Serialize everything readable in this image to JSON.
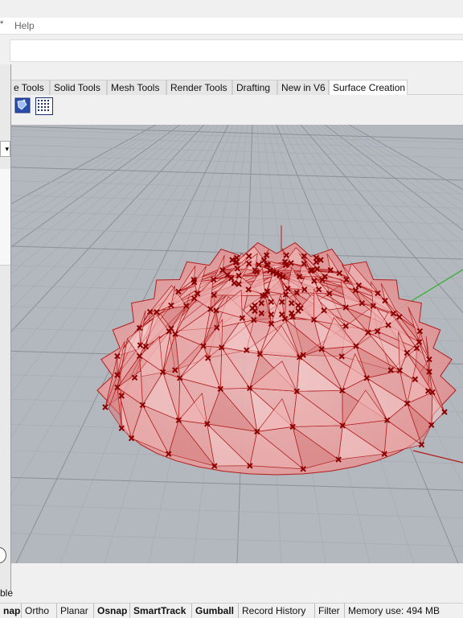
{
  "menu": {
    "mark": "*",
    "help": "Help"
  },
  "tabs": [
    {
      "label": "e Tools",
      "active": false
    },
    {
      "label": "Solid Tools",
      "active": false
    },
    {
      "label": "Mesh Tools",
      "active": false
    },
    {
      "label": "Render Tools",
      "active": false
    },
    {
      "label": "Drafting",
      "active": false
    },
    {
      "label": "New in V6",
      "active": false
    },
    {
      "label": "Surface Creation",
      "active": true
    }
  ],
  "toolbar_icons": [
    "surface-edit-icon",
    "point-grid-icon"
  ],
  "left_panel": {
    "layer_label": "ble"
  },
  "status_bar": [
    {
      "label": "nap",
      "bold": true
    },
    {
      "label": "Ortho",
      "bold": false
    },
    {
      "label": "Planar",
      "bold": false
    },
    {
      "label": "Osnap",
      "bold": true
    },
    {
      "label": "SmartTrack",
      "bold": true
    },
    {
      "label": "Gumball",
      "bold": true
    },
    {
      "label": "Record History",
      "bold": false
    },
    {
      "label": "Filter",
      "bold": false
    },
    {
      "label": "Memory use: 494 MB",
      "bold": false
    }
  ],
  "colors": {
    "viewport_bg": "#b3b7be",
    "grid_line": "#a5a9b0",
    "grid_major": "#8c9097",
    "object_fill": "#e8a0a0",
    "object_edge": "#b31c1c",
    "control_point": "#8b0000",
    "axis_y": "#2bb02b",
    "axis_x": "#b31c1c"
  }
}
